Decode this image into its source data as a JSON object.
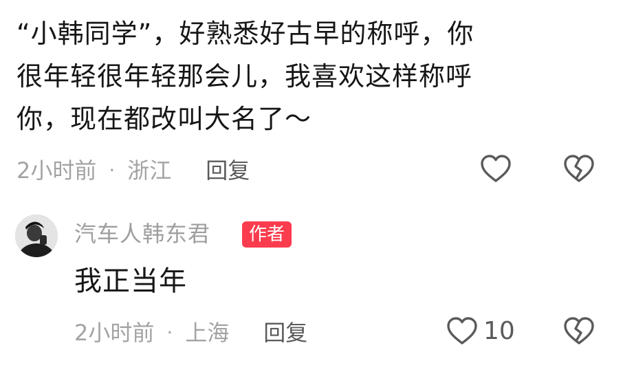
{
  "comment": {
    "lines": [
      "“小韩同学”，好熟悉好古早的称呼，你",
      "很年轻很年轻那会儿，我喜欢这样称呼",
      "你，现在都改叫大名了～"
    ],
    "time": "2小时前",
    "separator": "·",
    "location": "浙江",
    "reply_label": "回复",
    "like_icon": "heart-outline-icon",
    "dislike_icon": "broken-heart-icon"
  },
  "reply": {
    "username": "汽车人韩东君",
    "badge": "作者",
    "text": "我正当年",
    "time": "2小时前",
    "separator": "·",
    "location": "上海",
    "reply_label": "回复",
    "like_count": "10",
    "like_icon": "heart-outline-icon",
    "dislike_icon": "broken-heart-icon"
  },
  "colors": {
    "badge_bg": "#fb3c4e",
    "meta_gray": "#a3a3a3",
    "icon_gray": "#5a5a5a",
    "text": "#161616"
  }
}
